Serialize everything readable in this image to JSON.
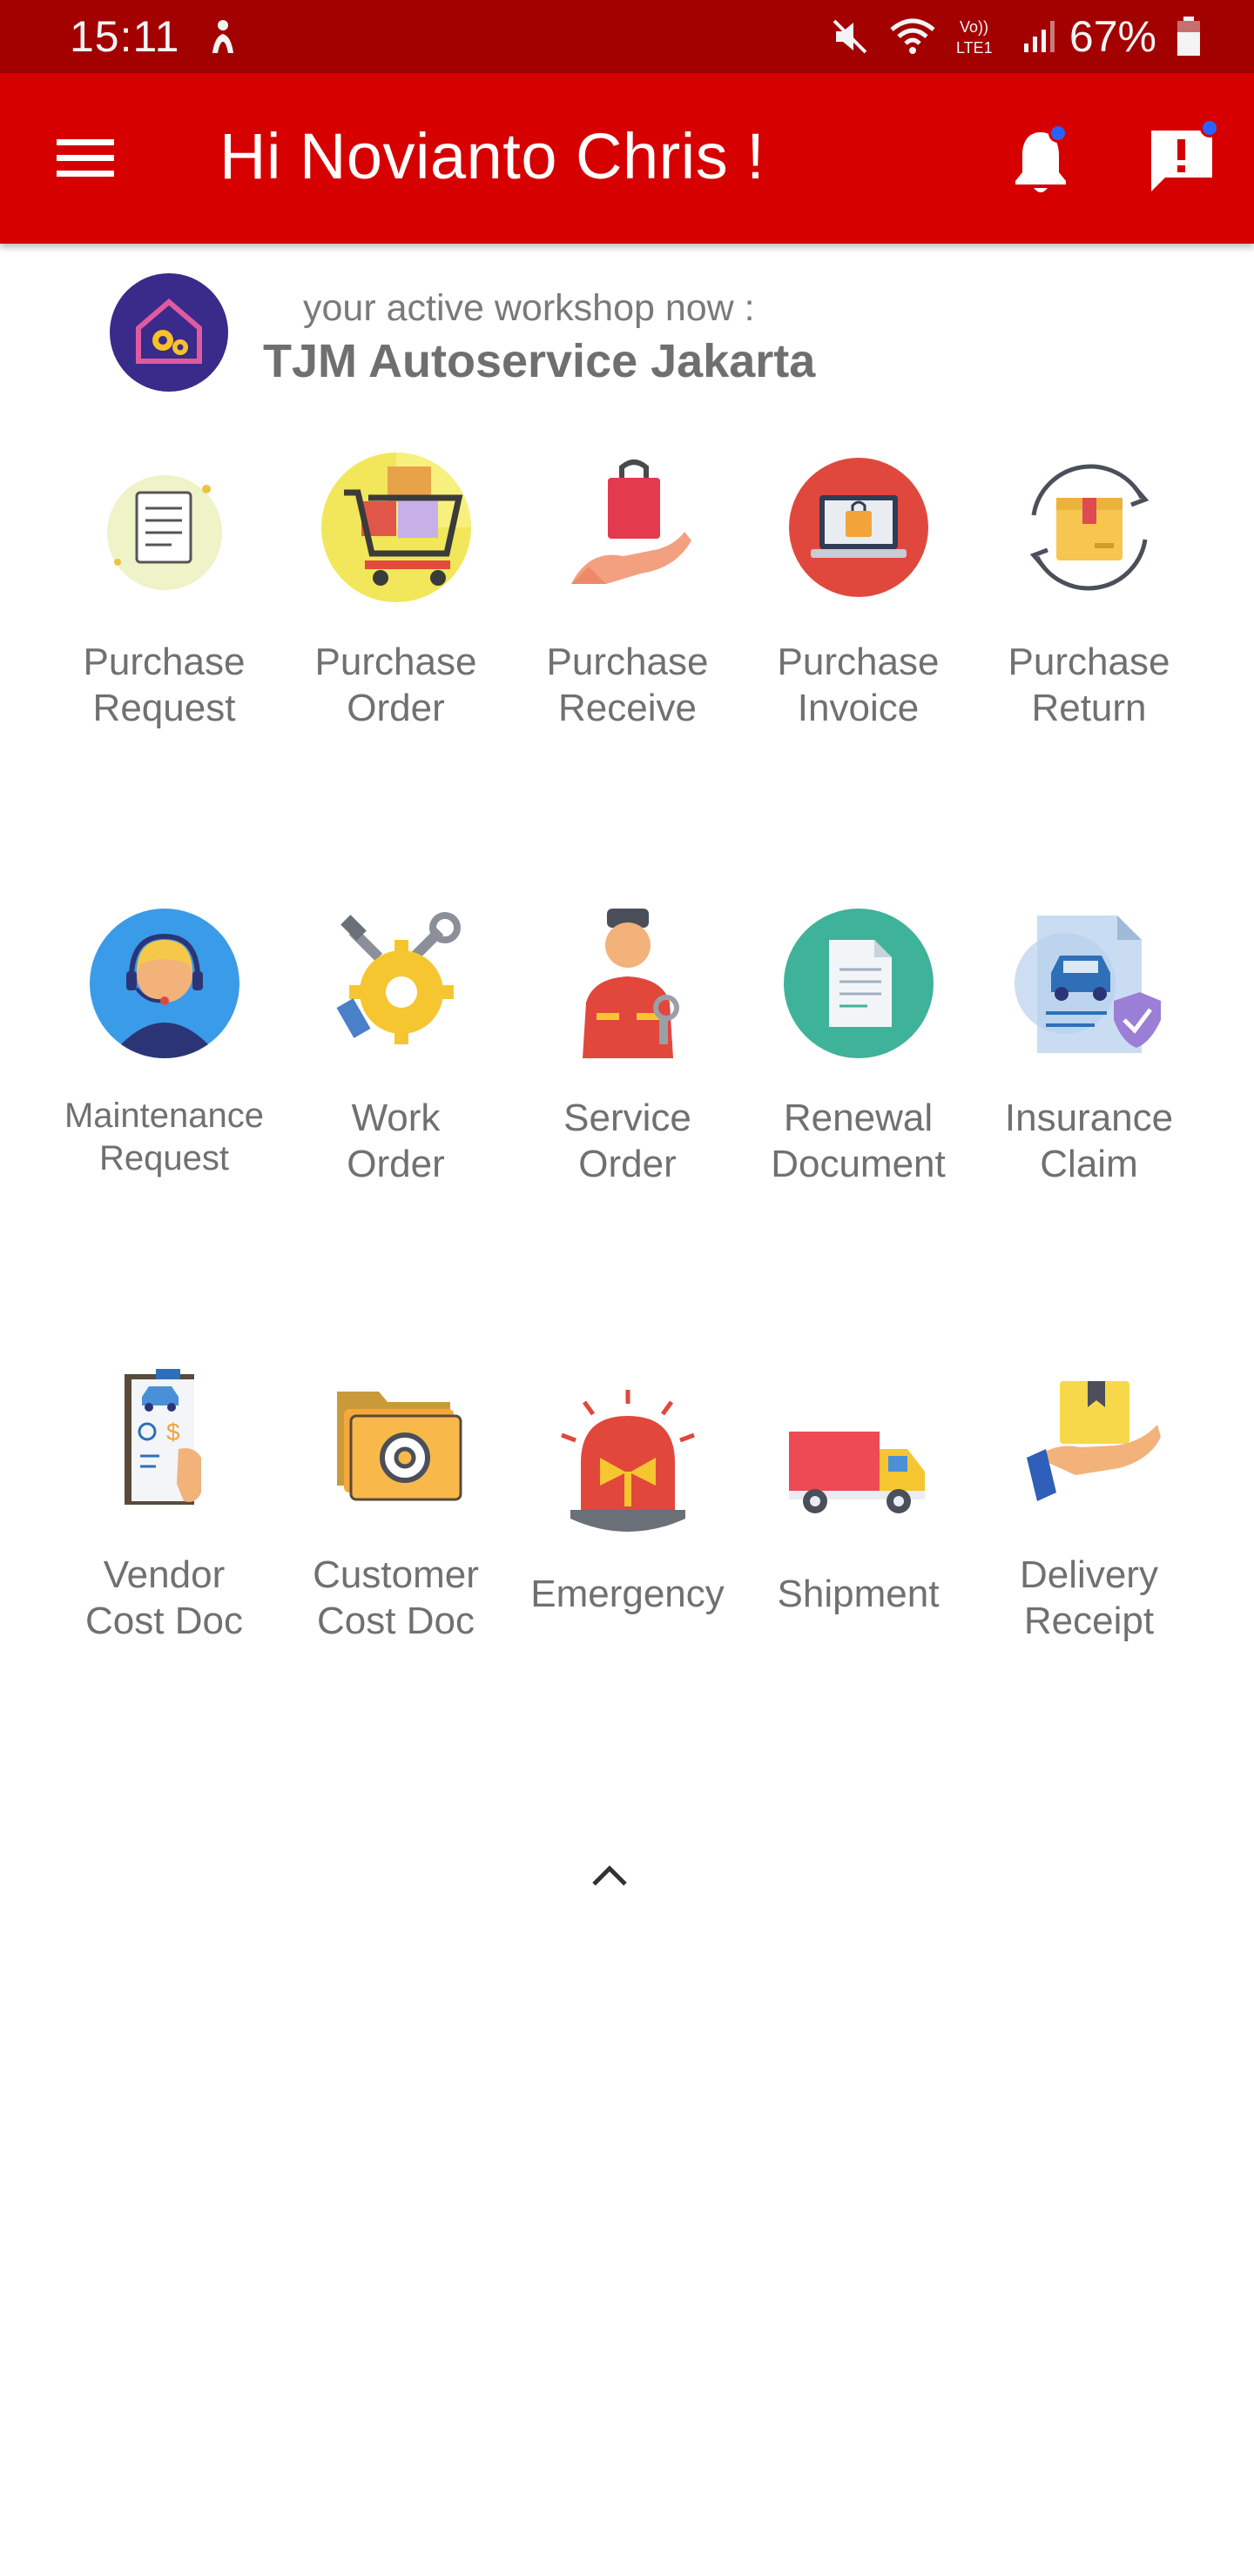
{
  "status_bar": {
    "time": "15:11",
    "battery_percent": "67%",
    "network_label_top": "Vo))",
    "network_label_bottom": "LTE1"
  },
  "app_bar": {
    "title": "Hi Novianto Chris !",
    "menu_icon": "hamburger-menu-icon",
    "bell_icon": "bell-icon",
    "feedback_icon": "feedback-icon",
    "accent_color": "#d60000",
    "status_color": "#a30000",
    "dot_color": "#2962ff"
  },
  "workshop": {
    "label": "your active workshop now :",
    "name": "TJM Autoservice Jakarta",
    "logo_icon": "workshop-house-gear-icon"
  },
  "menu": {
    "items": [
      {
        "label": "Purchase\nRequest",
        "icon": "receipt-scroll-icon"
      },
      {
        "label": "Purchase\nOrder",
        "icon": "shopping-cart-icon"
      },
      {
        "label": "Purchase\nReceive",
        "icon": "hand-bag-icon"
      },
      {
        "label": "Purchase\nInvoice",
        "icon": "laptop-bag-icon"
      },
      {
        "label": "Purchase\nReturn",
        "icon": "box-return-icon"
      },
      {
        "label": "Maintenance\nRequest",
        "icon": "headset-agent-icon"
      },
      {
        "label": "Work\nOrder",
        "icon": "tools-gear-icon"
      },
      {
        "label": "Service\nOrder",
        "icon": "mechanic-icon"
      },
      {
        "label": "Renewal\nDocument",
        "icon": "document-icon"
      },
      {
        "label": "Insurance\nClaim",
        "icon": "car-shield-icon"
      },
      {
        "label": "Vendor\nCost Doc",
        "icon": "vendor-cost-doc-icon"
      },
      {
        "label": "Customer\nCost Doc",
        "icon": "folder-gear-icon"
      },
      {
        "label": "Emergency",
        "icon": "siren-icon"
      },
      {
        "label": "Shipment",
        "icon": "truck-icon"
      },
      {
        "label": "Delivery\nReceipt",
        "icon": "hand-package-icon"
      }
    ]
  },
  "collapse_icon": "chevron-up-icon"
}
